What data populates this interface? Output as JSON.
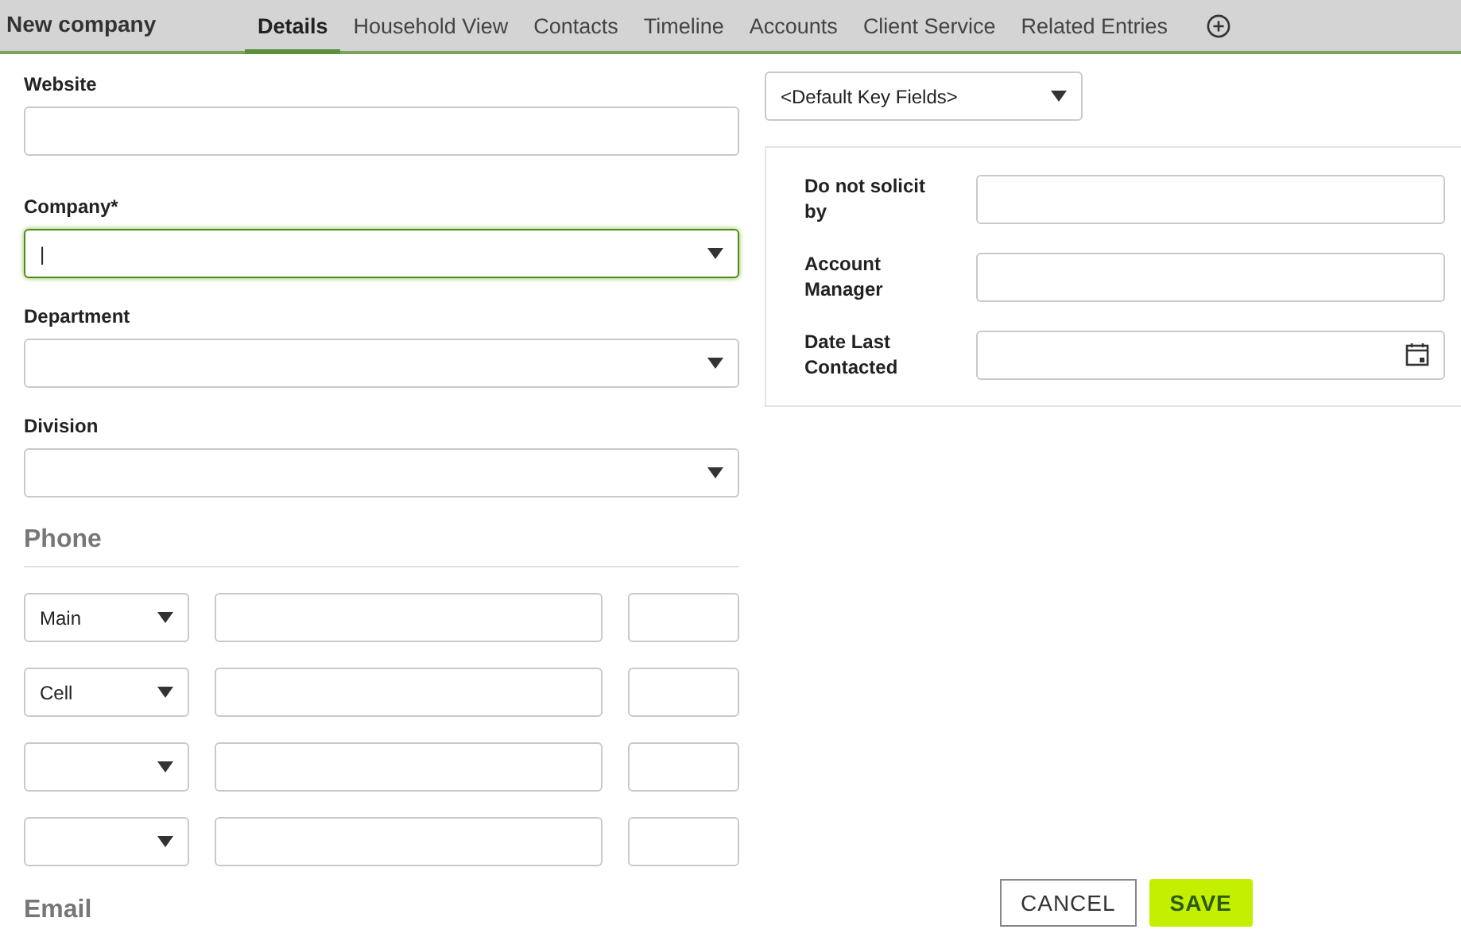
{
  "header": {
    "title": "New company"
  },
  "tabs": [
    {
      "label": "Details",
      "selected": true
    },
    {
      "label": "Household View",
      "selected": false
    },
    {
      "label": "Contacts",
      "selected": false
    },
    {
      "label": "Timeline",
      "selected": false
    },
    {
      "label": "Accounts",
      "selected": false
    },
    {
      "label": "Client Service",
      "selected": false
    },
    {
      "label": "Related Entries",
      "selected": false
    }
  ],
  "fields": [
    {
      "label": "Website",
      "kind": "text",
      "focused": false
    },
    {
      "label": "Company*",
      "kind": "select",
      "focused": true,
      "value": "|"
    },
    {
      "label": "Department",
      "kind": "select",
      "focused": false
    },
    {
      "label": "Division",
      "kind": "select",
      "focused": false
    }
  ],
  "phone": {
    "heading": "Phone",
    "rows": [
      {
        "type": "Main"
      },
      {
        "type": "Cell"
      },
      {},
      {}
    ]
  },
  "email": {
    "heading": "Email"
  },
  "key_fields": {
    "value": "<Default Key Fields>"
  },
  "key_panel": [
    {
      "label": "Do not solicit by",
      "kind": "text"
    },
    {
      "label": "Account Manager",
      "kind": "text"
    },
    {
      "label": "Date Last Contacted",
      "kind": "date"
    }
  ],
  "buttons": [
    {
      "label": "CANCEL",
      "kind": "secondary"
    },
    {
      "label": "SAVE",
      "kind": "primary"
    }
  ]
}
